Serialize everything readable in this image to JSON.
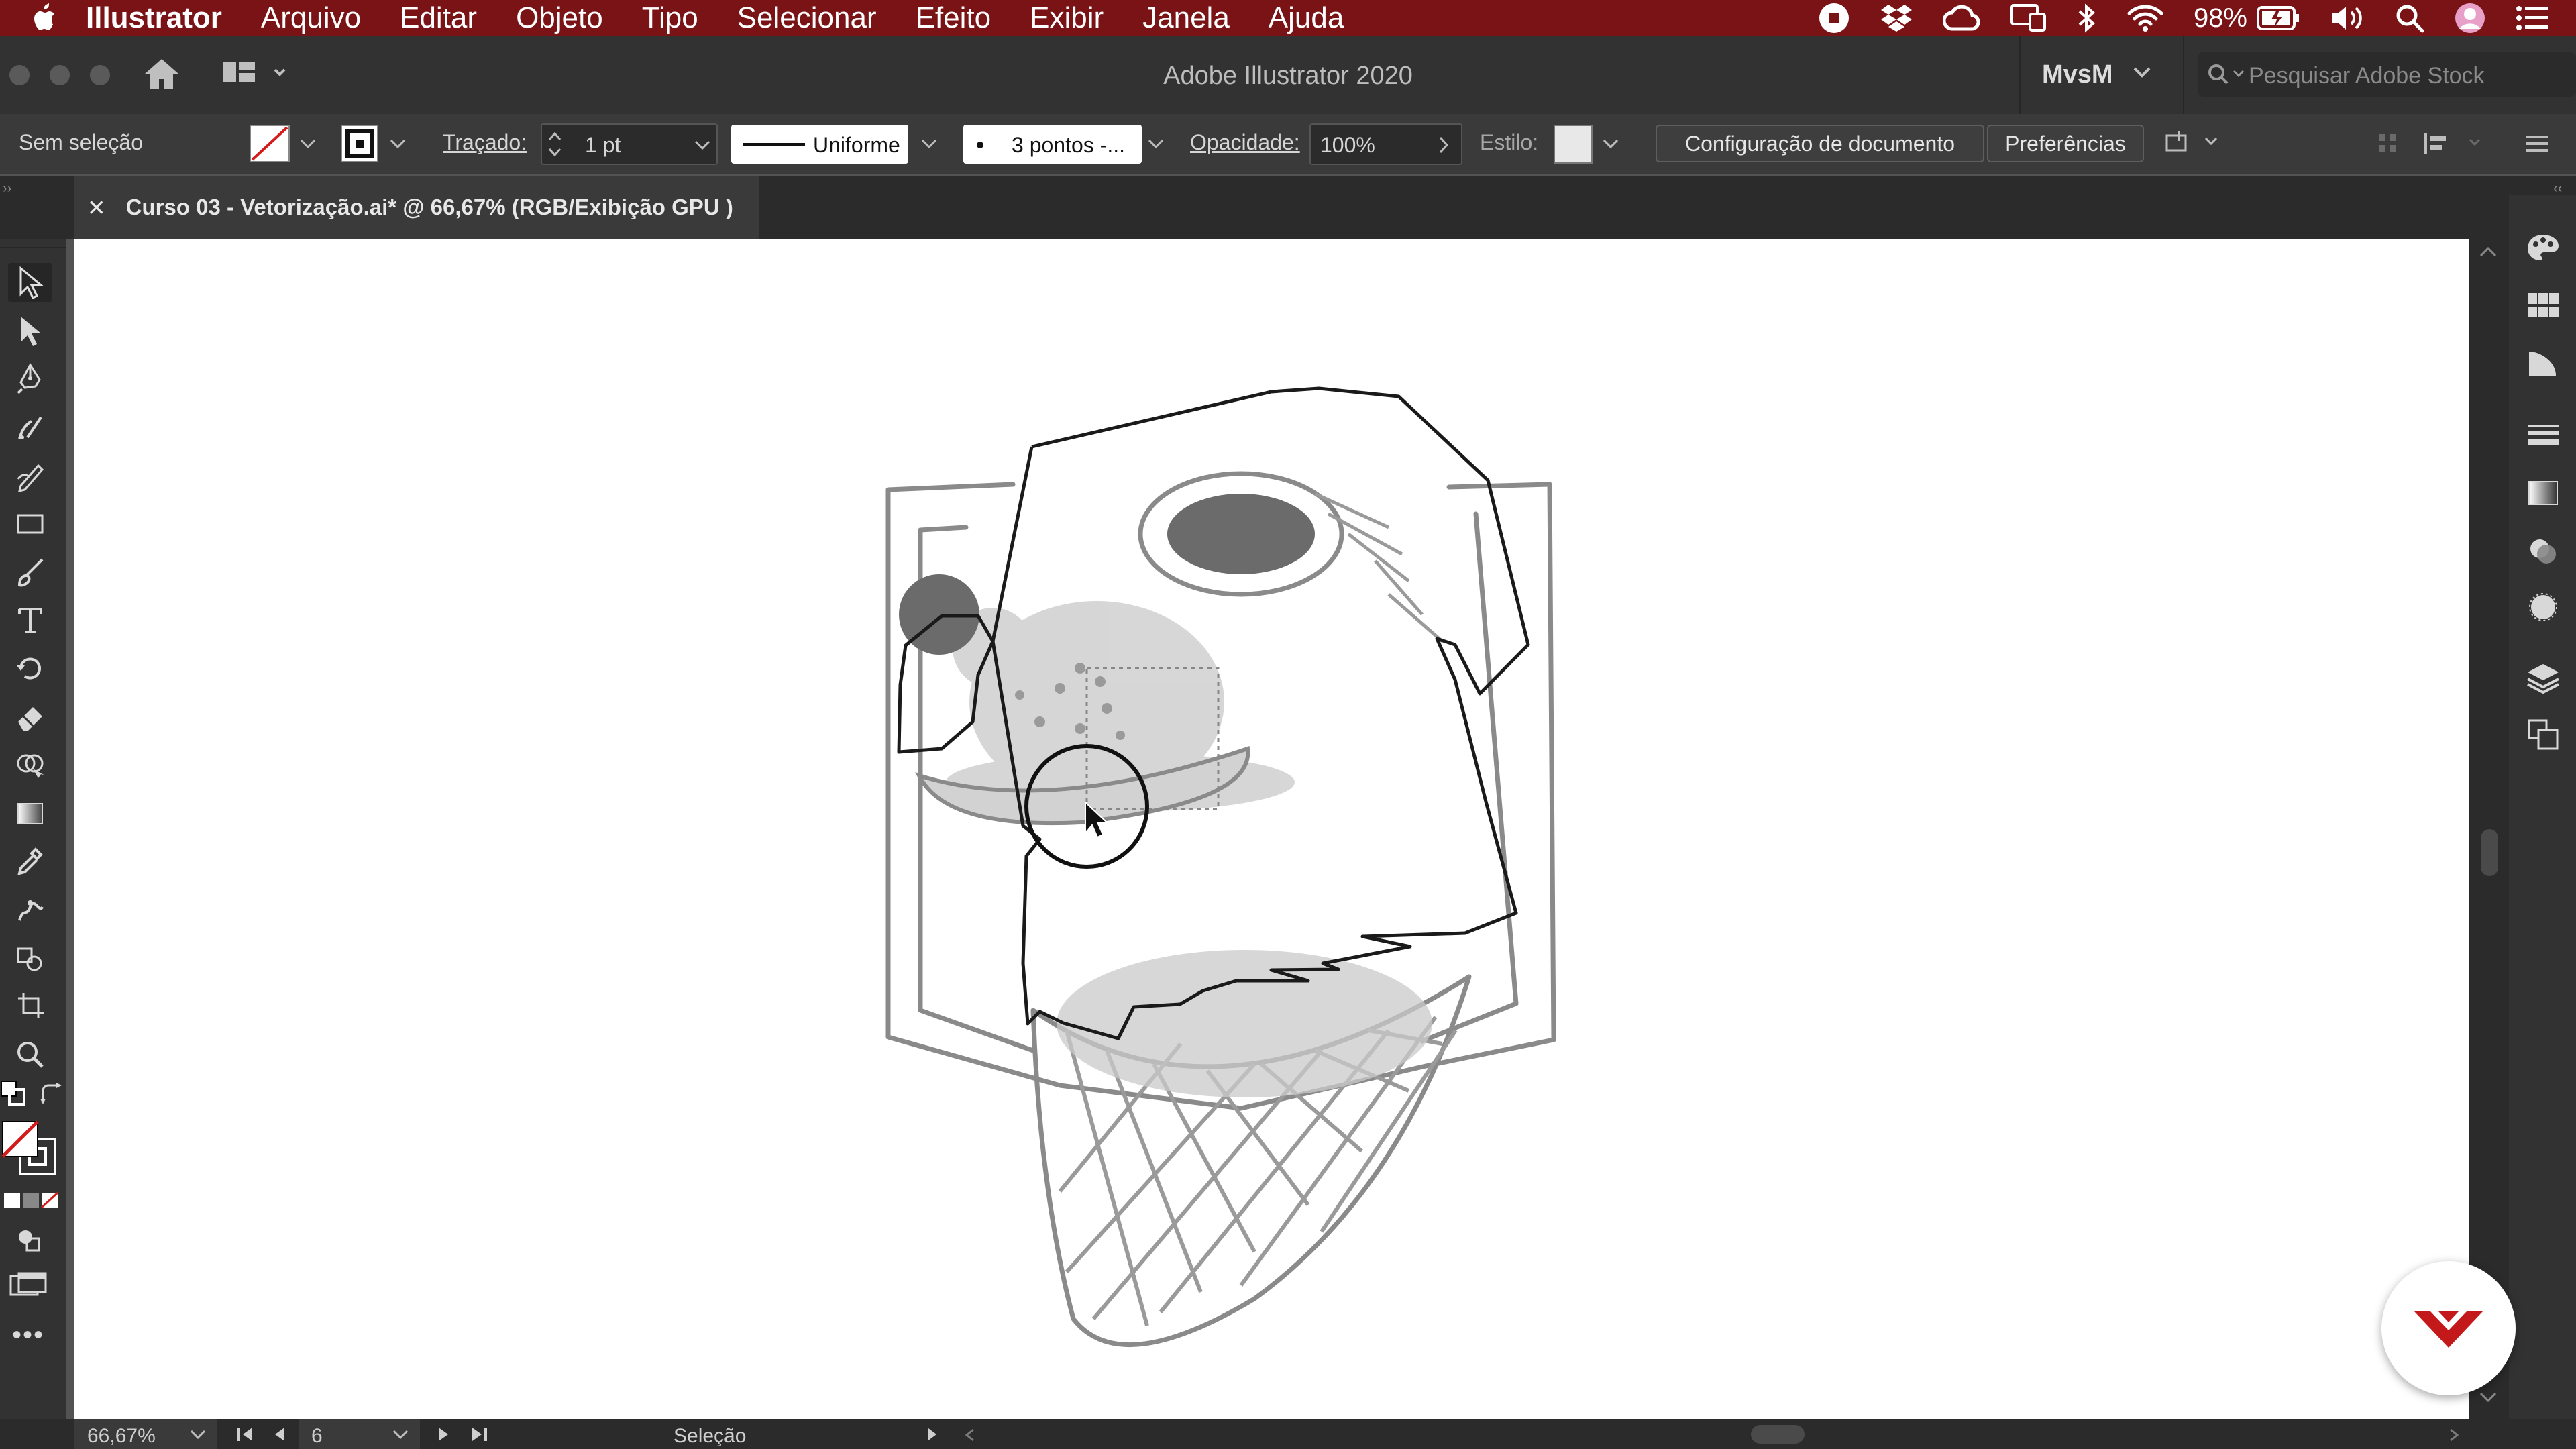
{
  "menubar": {
    "apple_icon": "apple-icon",
    "app_name": "Illustrator",
    "items": [
      "Arquivo",
      "Editar",
      "Objeto",
      "Tipo",
      "Selecionar",
      "Efeito",
      "Exibir",
      "Janela",
      "Ajuda"
    ],
    "battery": "98%",
    "bg_color": "#7a1315"
  },
  "titlebar": {
    "title": "Adobe Illustrator 2020",
    "workspace": "MvsM",
    "search_placeholder": "Pesquisar Adobe Stock"
  },
  "controlbar": {
    "selection_status": "Sem seleção",
    "stroke_label": "Traçado:",
    "stroke_weight": "1 pt",
    "stroke_profile": "Uniforme",
    "brush": "3 pontos -...",
    "opacity_label": "Opacidade:",
    "opacity_value": "100%",
    "style_label": "Estilo:",
    "doc_setup_button": "Configuração de documento",
    "preferences_button": "Preferências"
  },
  "document_tab": {
    "close_glyph": "✕",
    "title": "Curso 03 - Vetorização.ai* @ 66,67% (RGB/Exibição GPU )"
  },
  "tools": [
    {
      "name": "selection-tool-icon"
    },
    {
      "name": "direct-selection-tool-icon"
    },
    {
      "name": "pen-tool-icon"
    },
    {
      "name": "curvature-tool-icon"
    },
    {
      "name": "pencil-tool-icon"
    },
    {
      "name": "rectangle-tool-icon"
    },
    {
      "name": "paintbrush-tool-icon"
    },
    {
      "name": "type-tool-icon"
    },
    {
      "name": "rotate-tool-icon"
    },
    {
      "name": "eraser-tool-icon"
    },
    {
      "name": "shape-builder-tool-icon"
    },
    {
      "name": "gradient-tool-icon"
    },
    {
      "name": "eyedropper-tool-icon"
    },
    {
      "name": "puppet-warp-tool-icon"
    },
    {
      "name": "live-paint-tool-icon"
    },
    {
      "name": "artboard-tool-icon"
    },
    {
      "name": "zoom-tool-icon"
    }
  ],
  "statusbar": {
    "zoom": "66,67%",
    "artboard_number": "6",
    "current_tool": "Seleção"
  },
  "colors": {
    "accent_red": "#c4191b",
    "panel": "#323232",
    "canvas": "#ffffff"
  }
}
